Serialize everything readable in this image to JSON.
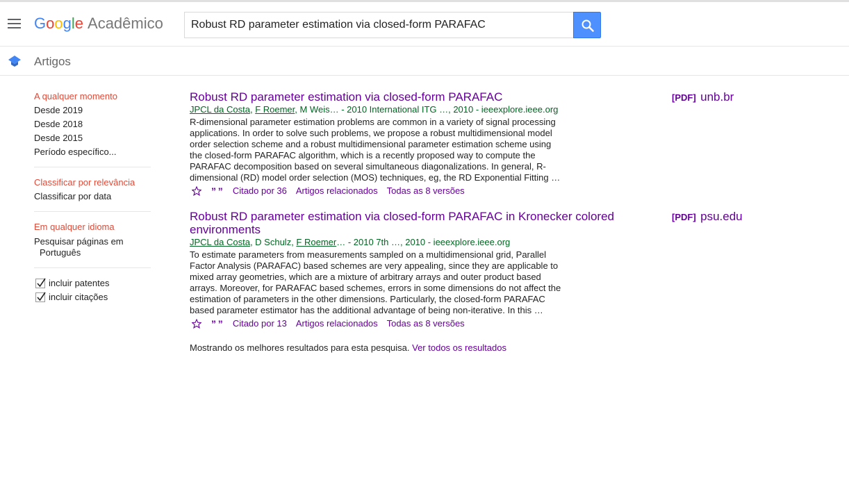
{
  "header": {
    "logo_google": [
      "G",
      "o",
      "o",
      "g",
      "l",
      "e"
    ],
    "logo_product": "Acadêmico",
    "search_value": "Robust RD parameter estimation via closed-form PARAFAC"
  },
  "subheader": {
    "title": "Artigos"
  },
  "sidebar": {
    "time": [
      "A qualquer momento",
      "Desde 2019",
      "Desde 2018",
      "Desde 2015",
      "Período específico..."
    ],
    "sort": [
      "Classificar por relevância",
      "Classificar por data"
    ],
    "language": {
      "any": "Em qualquer idioma",
      "search_pages_1": "Pesquisar páginas em",
      "search_pages_2": "Português"
    },
    "checks": [
      "incluir patentes",
      "incluir citações"
    ]
  },
  "results": [
    {
      "title": "Robust RD parameter estimation via closed-form PARAFAC",
      "authors_linked_1": "JPCL da Costa",
      "sep_1": ", ",
      "authors_linked_2": "F Roemer",
      "meta_rest": ", M Weis… - 2010 International ITG …, 2010 - ieeexplore.ieee.org",
      "snippet": "R-dimensional parameter estimation problems are common in a variety of signal processing applications. In order to solve such problems, we propose a robust multidimensional model order selection scheme and a robust multidimensional parameter estimation scheme using the closed-form PARAFAC algorithm, which is a recently proposed way to compute the PARAFAC decomposition based on several simultaneous diagonalizations. In general, R-dimensional (RD) model order selection (MOS) techniques, eg, the RD Exponential Fitting …",
      "cited": "Citado por 36",
      "related": "Artigos relacionados",
      "versions": "Todas as 8 versões",
      "pdf_tag": "[PDF]",
      "pdf_domain": "unb.br"
    },
    {
      "title": "Robust RD parameter estimation via closed-form PARAFAC in Kronecker colored environments",
      "authors_linked_1": "JPCL da Costa",
      "sep_1": ", D Schulz, ",
      "authors_linked_2": "F Roemer",
      "meta_rest": "… - 2010 7th …, 2010 - ieeexplore.ieee.org",
      "snippet": "To estimate parameters from measurements sampled on a multidimensional grid, Parallel Factor Analysis (PARAFAC) based schemes are very appealing, since they are applicable to mixed array geometries, which are a mixture of arbitrary arrays and outer product based arrays. Moreover, for PARAFAC based schemes, errors in some dimensions do not affect the estimation of parameters in the other dimensions. Particularly, the closed-form PARAFAC based parameter estimator has the additional advantage of being non-iterative. In this …",
      "cited": "Citado por 13",
      "related": "Artigos relacionados",
      "versions": "Todas as 8 versões",
      "pdf_tag": "[PDF]",
      "pdf_domain": "psu.edu"
    }
  ],
  "footer": {
    "text": "Mostrando os melhores resultados para esta pesquisa. ",
    "link": "Ver todos os resultados"
  },
  "colors": {
    "accent": "#4d90fe",
    "active": "#dd4b39",
    "link": "#660099",
    "meta": "#006621"
  }
}
